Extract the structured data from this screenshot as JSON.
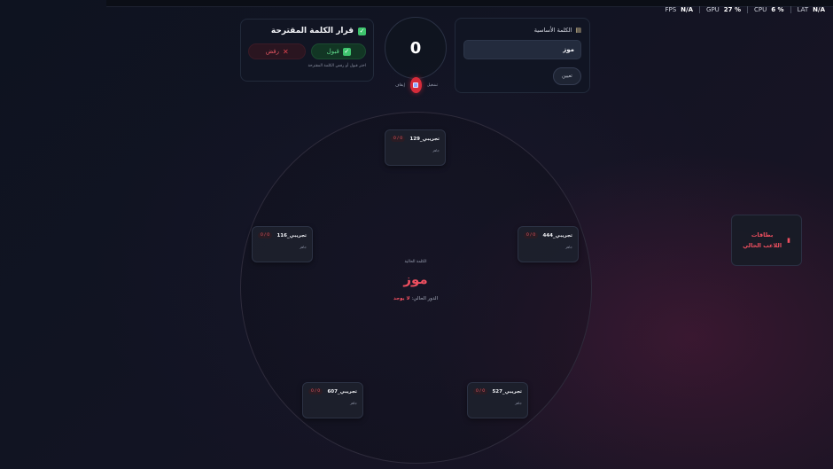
{
  "perf": [
    {
      "label": "FPS",
      "value": "N/A"
    },
    {
      "label": "GPU",
      "value": "27 %"
    },
    {
      "label": "CPU",
      "value": "6 %"
    },
    {
      "label": "LAT",
      "value": "N/A"
    }
  ],
  "decision": {
    "title": "قرار الكلمة المقترحة",
    "accept_label": "قبول",
    "reject_label": "رفض",
    "hint": "اختر قبول أو رفض الكلمة المقترحة"
  },
  "timer": {
    "value": "0",
    "label_left": "إيقاف",
    "label_right": "تشغيل"
  },
  "base_word": {
    "title": "الكلمة الأساسية",
    "value": "موز",
    "set_label": "تعيين"
  },
  "center": {
    "label": "الكلمة الحالية",
    "word": "موز",
    "turn_prefix": "الدور الحالي:",
    "turn_value": "لا يوجد"
  },
  "players": [
    {
      "name": "تجريبي_129",
      "score": "0 / 0",
      "status": "جاهز"
    },
    {
      "name": "تجريبي_444",
      "score": "0 / 0",
      "status": "جاهز"
    },
    {
      "name": "تجريبي_527",
      "score": "0 / 0",
      "status": "جاهز"
    },
    {
      "name": "تجريبي_607",
      "score": "0 / 0",
      "status": "جاهز"
    },
    {
      "name": "تجريبي_116",
      "score": "0 / 0",
      "status": "جاهز"
    }
  ],
  "cards_panel": {
    "line1": "بطاقات",
    "line2": "اللاعب الحالي"
  },
  "colors": {
    "accent_red": "#ee4f5f",
    "accept_green": "#5fd98b",
    "background": "#121423"
  }
}
